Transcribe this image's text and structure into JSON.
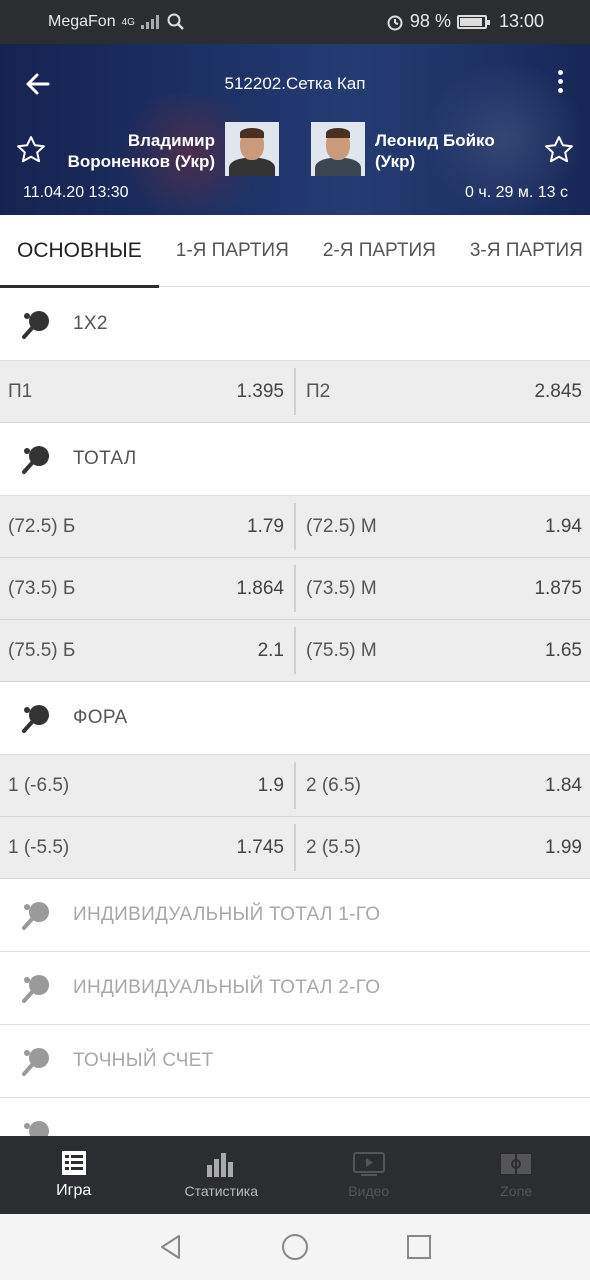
{
  "status_bar": {
    "carrier": "MegaFon",
    "network": "4G",
    "battery": "98 %",
    "time": "13:00"
  },
  "header": {
    "title": "512202.Сетка Кап",
    "player1": {
      "line1": "Владимир",
      "line2": "Вороненков (Укр)"
    },
    "player2": {
      "line1": "Леонид Бойко",
      "line2": "(Укр)"
    },
    "date": "11.04.20 13:30",
    "timer": "0 ч. 29 м. 13 с"
  },
  "tabs": [
    "ОСНОВНЫЕ",
    "1-Я ПАРТИЯ",
    "2-Я ПАРТИЯ",
    "3-Я ПАРТИЯ"
  ],
  "markets": [
    {
      "title": "1X2",
      "rows": [
        {
          "l_name": "П1",
          "l_odd": "1.395",
          "r_name": "П2",
          "r_odd": "2.845"
        }
      ]
    },
    {
      "title": "ТОТАЛ",
      "rows": [
        {
          "l_name": "(72.5) Б",
          "l_odd": "1.79",
          "r_name": "(72.5) М",
          "r_odd": "1.94"
        },
        {
          "l_name": "(73.5) Б",
          "l_odd": "1.864",
          "r_name": "(73.5) М",
          "r_odd": "1.875"
        },
        {
          "l_name": "(75.5) Б",
          "l_odd": "2.1",
          "r_name": "(75.5) М",
          "r_odd": "1.65"
        }
      ]
    },
    {
      "title": "ФОРА",
      "rows": [
        {
          "l_name": "1 (-6.5)",
          "l_odd": "1.9",
          "r_name": "2 (6.5)",
          "r_odd": "1.84"
        },
        {
          "l_name": "1 (-5.5)",
          "l_odd": "1.745",
          "r_name": "2 (5.5)",
          "r_odd": "1.99"
        }
      ]
    }
  ],
  "collapsed_markets": [
    "ИНДИВИДУАЛЬНЫЙ ТОТАЛ 1-ГО",
    "ИНДИВИДУАЛЬНЫЙ ТОТАЛ 2-ГО",
    "ТОЧНЫЙ СЧЕТ"
  ],
  "bottom_nav": [
    {
      "label": "Игра",
      "icon": "list-icon",
      "state": "active"
    },
    {
      "label": "Статистика",
      "icon": "bar-chart-icon",
      "state": "normal"
    },
    {
      "label": "Видео",
      "icon": "video-icon",
      "state": "disabled"
    },
    {
      "label": "Zone",
      "icon": "field-icon",
      "state": "disabled"
    }
  ],
  "colors": {
    "bar": "#2b2d31",
    "row_bg": "#ededed",
    "text": "#555555",
    "dim_text": "#a8a8a8"
  }
}
